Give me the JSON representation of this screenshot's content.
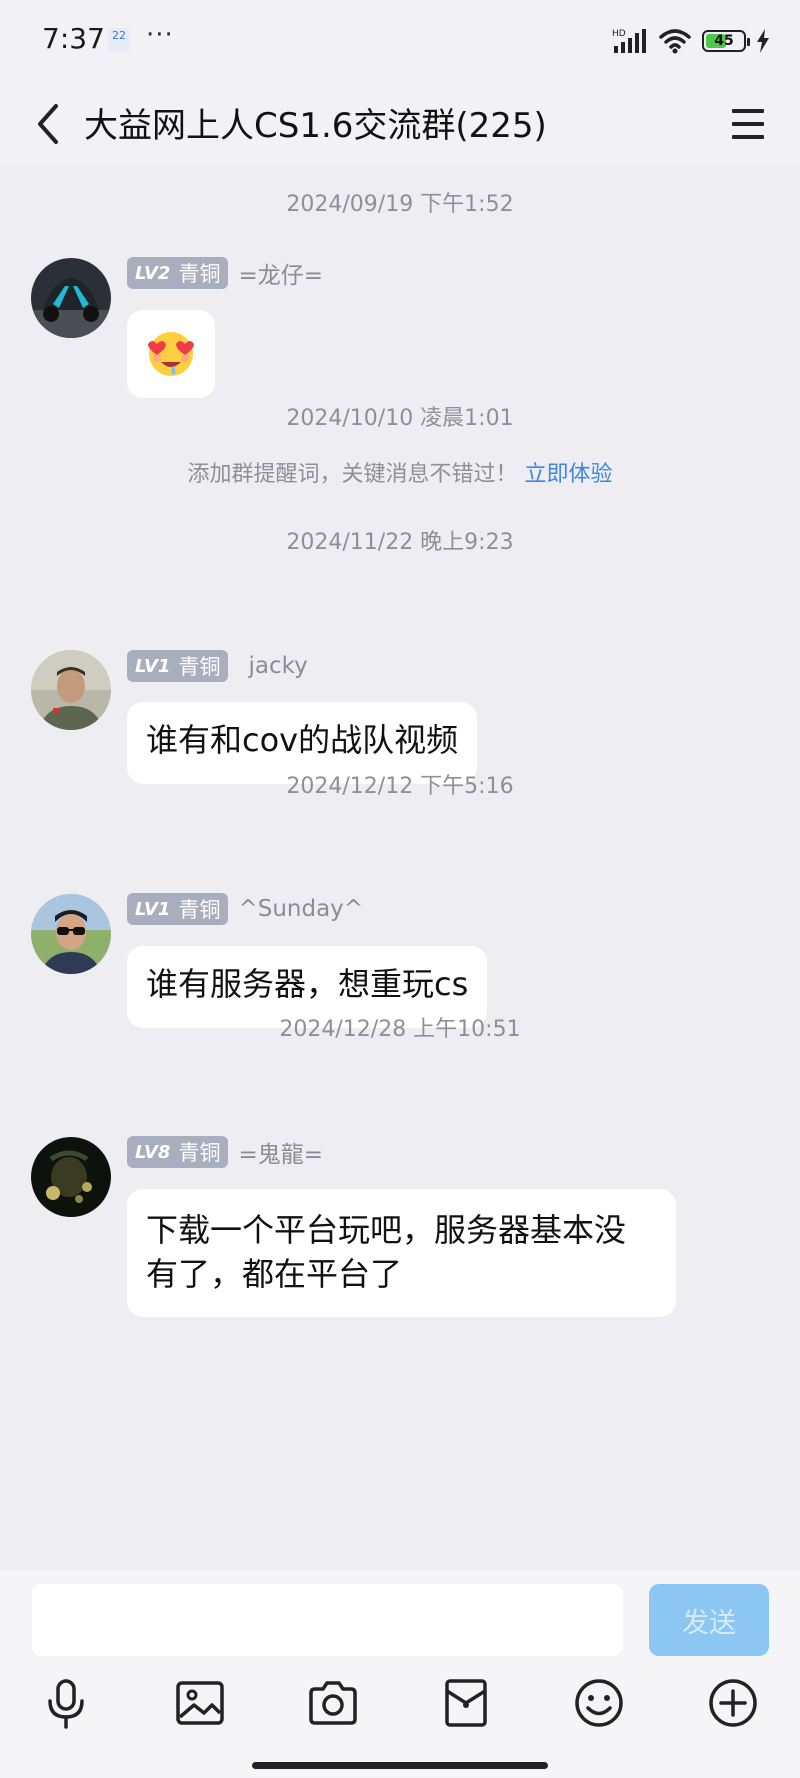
{
  "status_bar": {
    "time": "7:37",
    "calendar_day": "22",
    "dots": "···",
    "network": "HD",
    "battery_level": "45"
  },
  "header": {
    "title": "大益网上人CS1.6交流群(225)"
  },
  "messages": {
    "time_1": "2024/09/19 下午1:52",
    "msg_1": {
      "level": "LV2",
      "rank": "青铜",
      "nickname": "=龙仔=",
      "emoji": "heart-eyes-face"
    },
    "time_2": "2024/10/10 凌晨1:01",
    "notice_text": "添加群提醒词，关键消息不错过！",
    "notice_link": "立即体验",
    "time_3": "2024/11/22 晚上9:23",
    "msg_2": {
      "level": "LV1",
      "rank": "青铜",
      "nickname": "jacky",
      "text": "谁有和cov的战队视频"
    },
    "time_4": "2024/12/12 下午5:16",
    "msg_3": {
      "level": "LV1",
      "rank": "青铜",
      "nickname": "^Sunday^",
      "text": "谁有服务器，想重玩cs"
    },
    "time_5": "2024/12/28 上午10:51",
    "msg_4": {
      "level": "LV8",
      "rank": "青铜",
      "nickname": "=鬼龍=",
      "text": "下载一个平台玩吧，服务器基本没有了，都在平台了"
    }
  },
  "input": {
    "placeholder": "",
    "send_label": "发送"
  },
  "colors": {
    "background": "#ededf2",
    "badge": "#a9aebf",
    "link": "#3f86e0",
    "send_button": "#8cc7f3"
  }
}
